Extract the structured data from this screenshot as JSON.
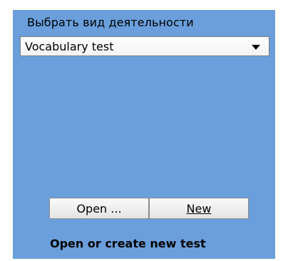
{
  "activity": {
    "label": "Выбрать вид деятельности",
    "selected": "Vocabulary test"
  },
  "actions": {
    "open_label": "Open ...",
    "new_label": "New"
  },
  "status_text": "Open or create new test",
  "colors": {
    "panel_background": "#6a9fdc"
  },
  "icons": {
    "dropdown": "chevron-down-icon"
  }
}
